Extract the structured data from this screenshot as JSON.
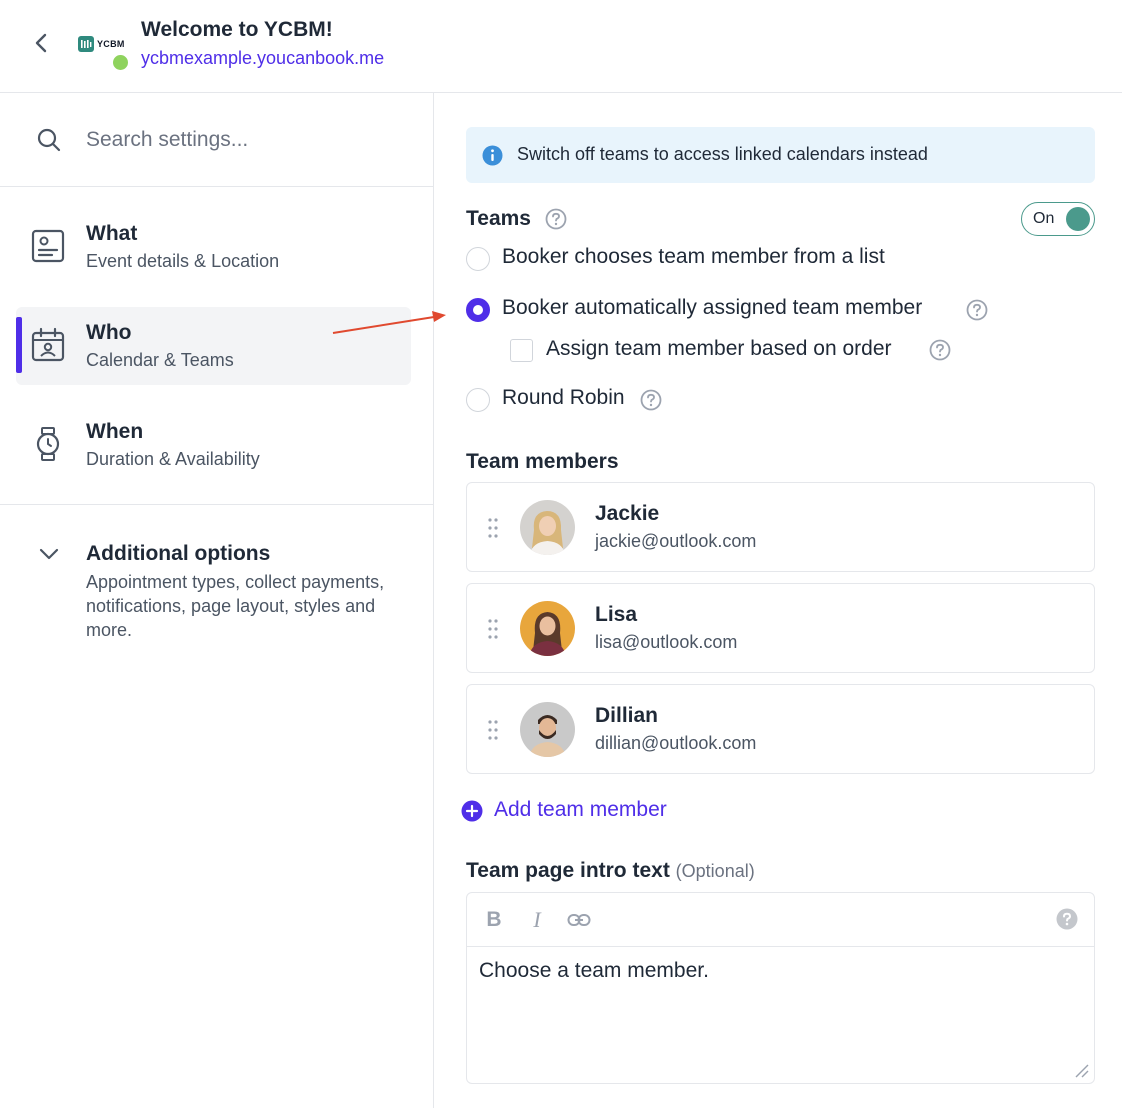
{
  "header": {
    "title": "Welcome to YCBM!",
    "url": "ycbmexample.youcanbook.me",
    "logo_text": "YCBM",
    "status_color": "#8fd35e"
  },
  "sidebar": {
    "search_placeholder": "Search settings...",
    "items": [
      {
        "title": "What",
        "subtitle": "Event details & Location",
        "icon": "profile-card-icon"
      },
      {
        "title": "Who",
        "subtitle": "Calendar & Teams",
        "icon": "calendar-person-icon",
        "active": true
      },
      {
        "title": "When",
        "subtitle": "Duration & Availability",
        "icon": "watch-icon"
      }
    ],
    "additional": {
      "title": "Additional options",
      "subtitle": "Appointment types, collect payments, notifications, page layout, styles and more."
    }
  },
  "main": {
    "info_text": "Switch off teams to access linked calendars instead",
    "teams": {
      "title": "Teams",
      "toggle_label": "On",
      "toggle_on": true,
      "options": [
        {
          "label": "Booker chooses team member from a list",
          "checked": false
        },
        {
          "label": "Booker automatically assigned team member",
          "checked": true
        },
        {
          "label": "Round Robin",
          "checked": false
        }
      ],
      "assign_by_order_label": "Assign team member based on order",
      "assign_by_order_checked": false
    },
    "members_title": "Team members",
    "members": [
      {
        "name": "Jackie",
        "email": "jackie@outlook.com"
      },
      {
        "name": "Lisa",
        "email": "lisa@outlook.com"
      },
      {
        "name": "Dillian",
        "email": "dillian@outlook.com"
      }
    ],
    "add_member_label": "Add team member",
    "intro": {
      "title": "Team page intro text",
      "optional": "(Optional)",
      "bold_label": "B",
      "italic_label": "I",
      "text": "Choose a team member."
    }
  },
  "colors": {
    "accent": "#4f2ee8",
    "toggle": "#4b9a8c",
    "arrow": "#e0492f",
    "info_bg": "#e8f4fc"
  }
}
